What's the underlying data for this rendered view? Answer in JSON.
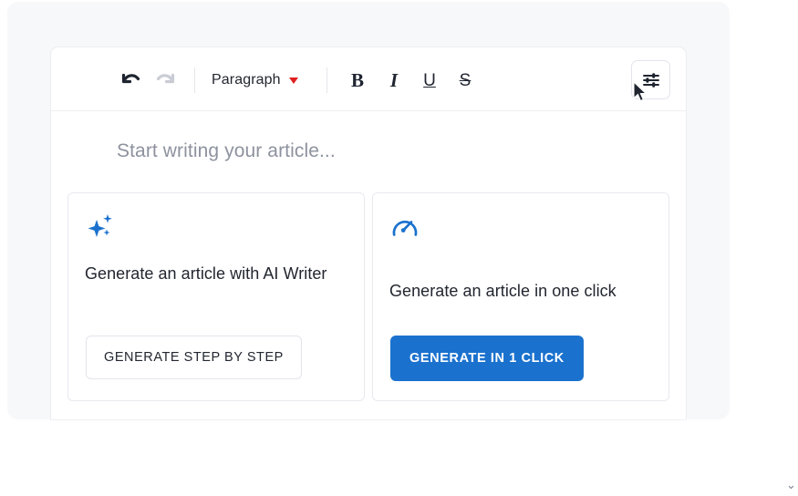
{
  "editor": {
    "toolbar": {
      "undo_label": "↶",
      "undo_name": "undo-icon",
      "redo_label": "↷",
      "redo_name": "redo-icon",
      "style_selected": "Paragraph",
      "bold_label": "B",
      "italic_label": "I",
      "underline_label": "U",
      "strikethrough_label": "S",
      "settings_icon": "tune-sliders-icon"
    },
    "placeholder": "Start writing your article...",
    "cards": [
      {
        "icon": "sparkles-icon",
        "title": "Generate an article with AI Writer",
        "button_label": "GENERATE STEP BY STEP",
        "button_style": "outline"
      },
      {
        "icon": "speedometer-icon",
        "title": "Generate an article in one click",
        "button_label": "GENERATE IN 1 CLICK",
        "button_style": "primary"
      }
    ]
  },
  "scroll_indicator": "⌄",
  "colors": {
    "primary": "#1b72ce",
    "accent_caret": "#e02020",
    "page_panel": "#f7f8fa",
    "text": "#22262f",
    "muted_text": "#8d929e",
    "border": "#e9e9ef"
  }
}
